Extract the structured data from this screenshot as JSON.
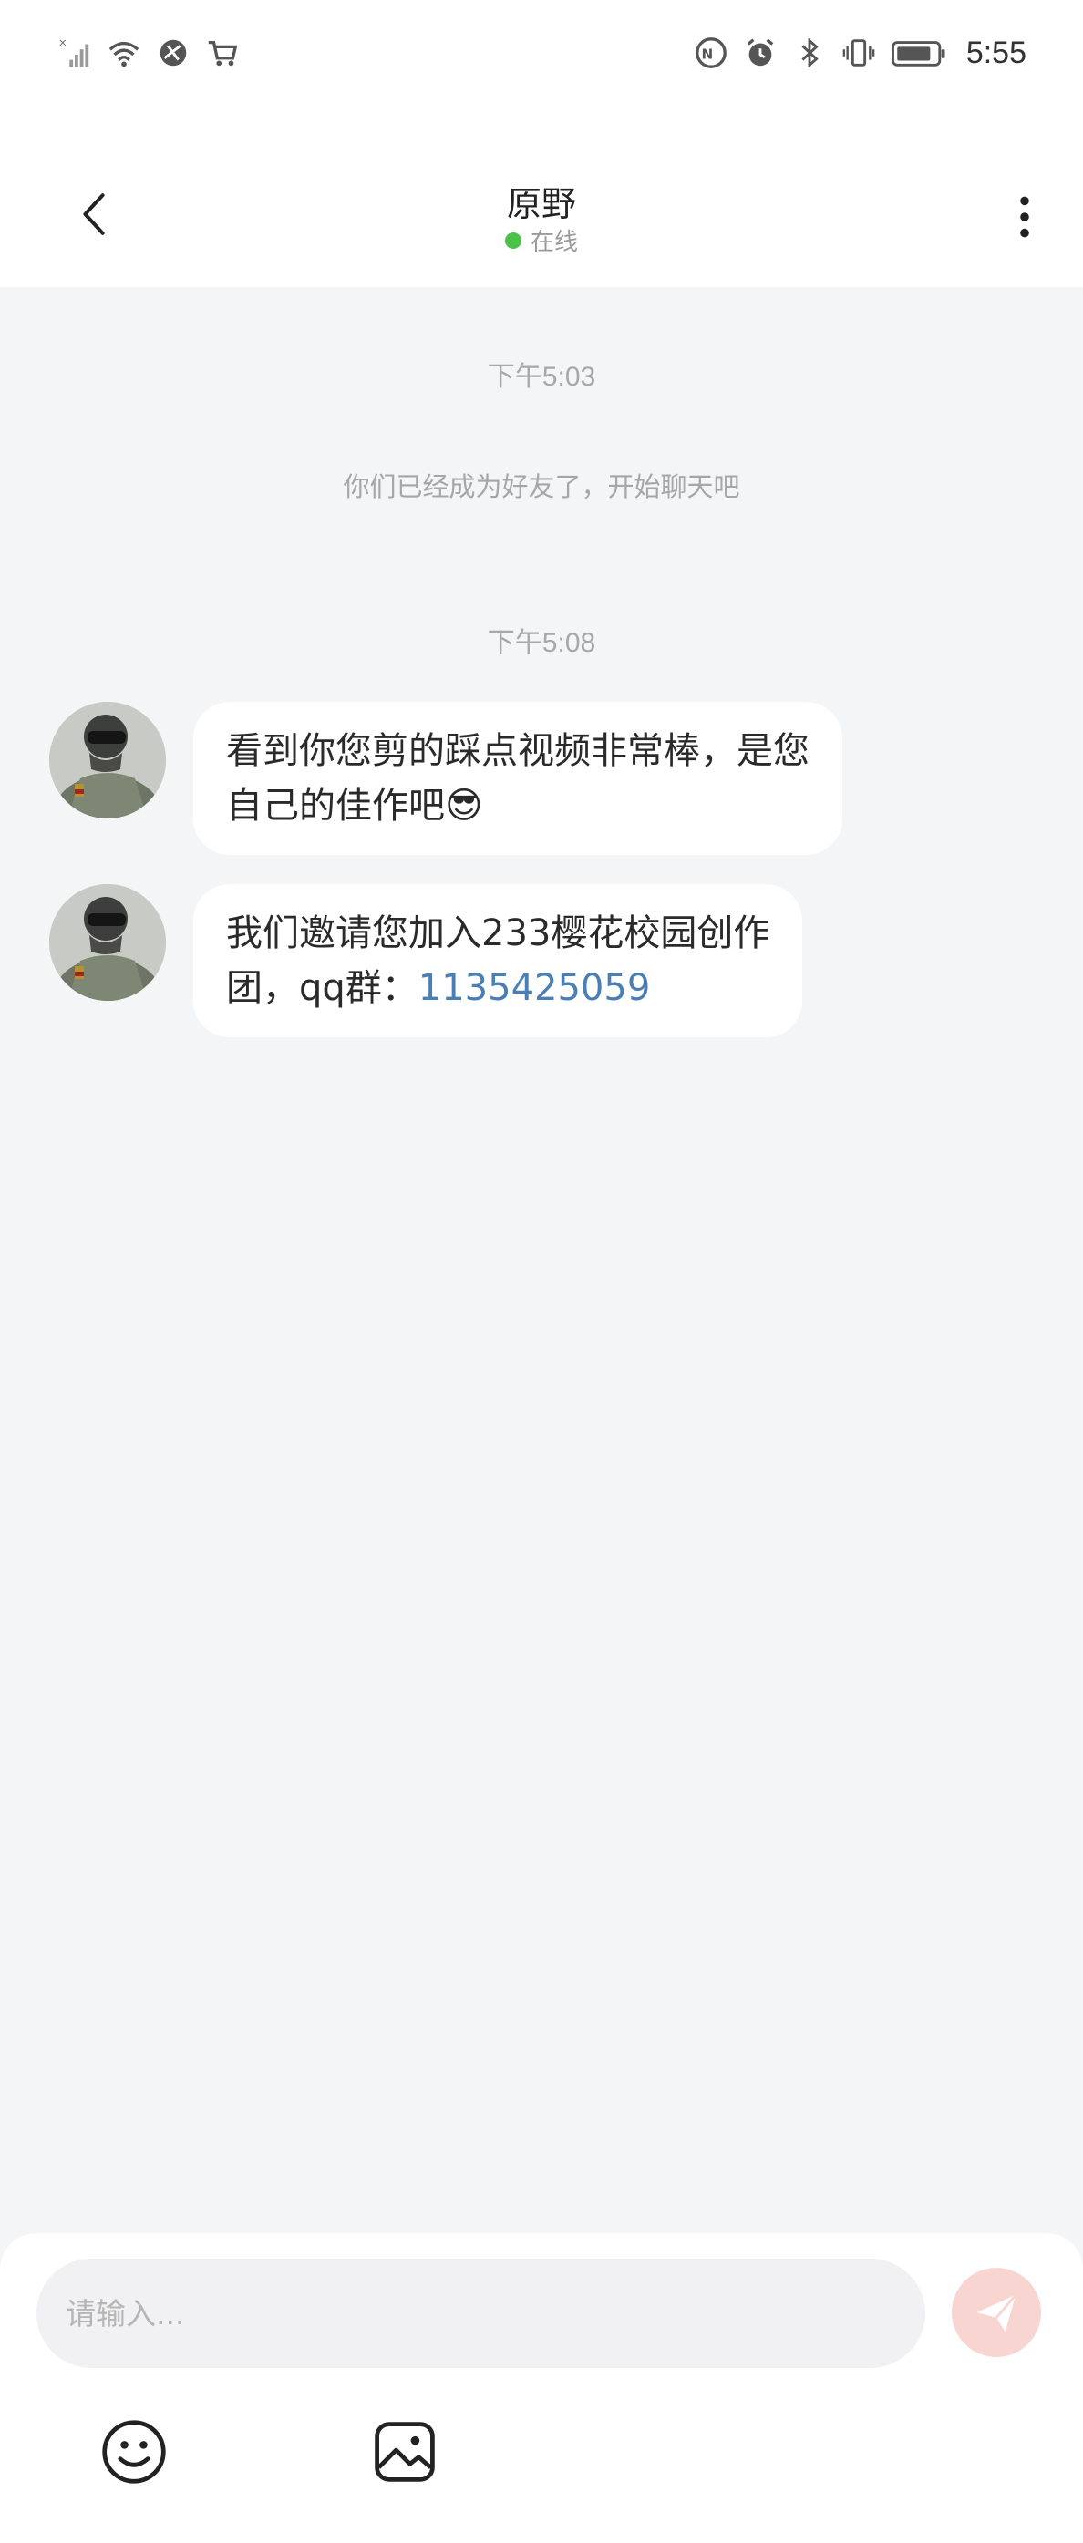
{
  "status_bar": {
    "time": "5:55",
    "left_icons": [
      "no-signal-icon",
      "wifi-icon",
      "browser-icon",
      "cart-icon"
    ],
    "right_icons": [
      "nfc-icon",
      "alarm-icon",
      "bluetooth-icon",
      "vibrate-icon",
      "battery-icon"
    ]
  },
  "header": {
    "title": "原野",
    "status": "在线",
    "status_color": "#4cc14a"
  },
  "chat": {
    "items": [
      {
        "type": "time",
        "text": "下午5:03"
      },
      {
        "type": "system",
        "text": "你们已经成为好友了，开始聊天吧"
      },
      {
        "type": "time",
        "text": "下午5:08"
      },
      {
        "type": "message",
        "line1": "看到你您剪的踩点视频非常棒，是您",
        "line2": "自己的佳作吧",
        "emoji": "😎"
      },
      {
        "type": "message",
        "line1": "我们邀请您加入233樱花校园创作",
        "line2_prefix": "团，qq群：",
        "link": "1135425059"
      }
    ]
  },
  "composer": {
    "placeholder": "请输入...",
    "send_button_color": "#f9d5d2",
    "tools": [
      "emoji-icon",
      "image-icon"
    ]
  },
  "colors": {
    "background": "#f4f5f7",
    "bubble": "#ffffff",
    "link": "#4a7fb5"
  }
}
